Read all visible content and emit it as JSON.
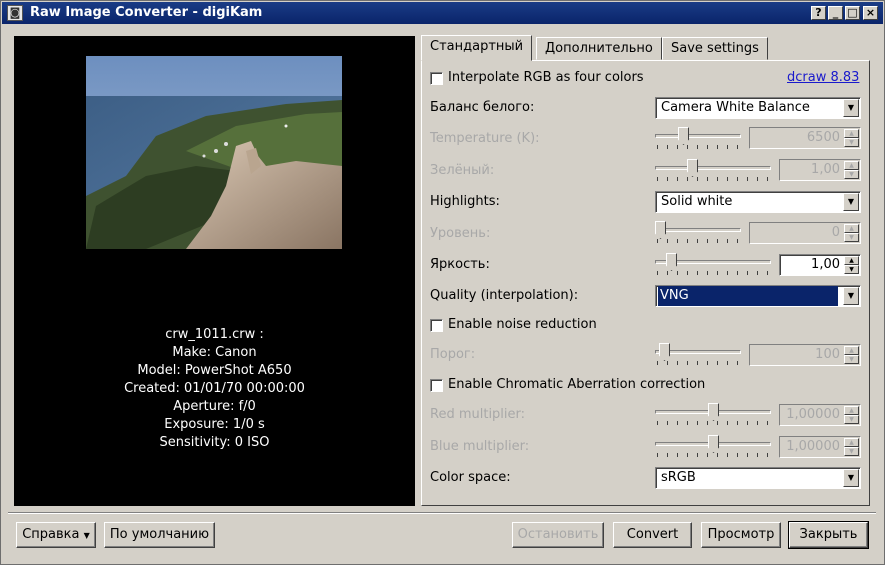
{
  "window": {
    "title": "Raw Image Converter - digiKam",
    "controls": [
      "?",
      "_",
      "□",
      "×"
    ]
  },
  "preview": {
    "info_lines": [
      "crw_1011.crw :",
      "Make: Canon",
      "Model: PowerShot A650",
      "Created: 01/01/70 00:00:00",
      "Aperture: f/0",
      "Exposure: 1/0 s",
      "Sensitivity: 0 ISO"
    ]
  },
  "tabs": [
    "Стандартный",
    "Дополнительно",
    "Save settings"
  ],
  "settings": {
    "interpolate_rgb": {
      "label": "Interpolate RGB as four colors",
      "checked": false
    },
    "dcraw_link": "dcraw 8.83",
    "white_balance": {
      "label": "Баланс белого:",
      "value": "Camera White Balance"
    },
    "temperature": {
      "label": "Temperature (K):",
      "value": "6500",
      "slider": 0.3,
      "enabled": false
    },
    "green": {
      "label": "Зелёный:",
      "value": "1,00",
      "slider": 0.3,
      "enabled": false
    },
    "highlights": {
      "label": "Highlights:",
      "value": "Solid white"
    },
    "level": {
      "label": "Уровень:",
      "value": "0",
      "slider": 0.0,
      "enabled": false
    },
    "brightness": {
      "label": "Яркость:",
      "value": "1,00",
      "slider": 0.1,
      "enabled": true
    },
    "quality": {
      "label": "Quality (interpolation):",
      "value": "VNG"
    },
    "noise_reduction": {
      "label": "Enable noise reduction",
      "checked": false
    },
    "threshold": {
      "label": "Порог:",
      "value": "100",
      "slider": 0.05,
      "enabled": false
    },
    "chromatic": {
      "label": "Enable Chromatic Aberration correction",
      "checked": false
    },
    "red_multiplier": {
      "label": "Red multiplier:",
      "value": "1,00000",
      "slider": 0.5,
      "enabled": false
    },
    "blue_multiplier": {
      "label": "Blue multiplier:",
      "value": "1,00000",
      "slider": 0.5,
      "enabled": false
    },
    "color_space": {
      "label": "Color space:",
      "value": "sRGB"
    }
  },
  "buttons": {
    "help": "Справка",
    "defaults": "По умолчанию",
    "abort": "Остановить",
    "convert": "Convert",
    "preview": "Просмотр",
    "close": "Закрыть"
  },
  "colors": {
    "titlebar": "#0a246a",
    "selection": "#0a246a",
    "link": "#1a1acc",
    "disabled_text": "#a8a8a8"
  }
}
